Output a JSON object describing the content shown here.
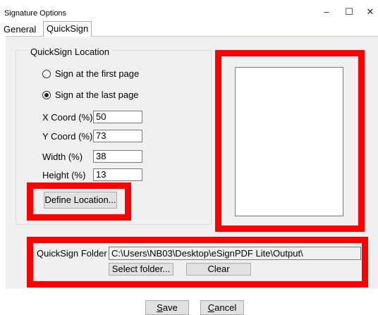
{
  "window": {
    "title": "Signature Options",
    "minimize_glyph": "–",
    "maximize_glyph": "☐",
    "close_glyph": "✕"
  },
  "tabs": [
    {
      "label": "General",
      "active": false
    },
    {
      "label": "QuickSign",
      "active": true
    }
  ],
  "location_group": {
    "title": "QuickSign Location",
    "radio_first": {
      "label": "Sign at the first page",
      "checked": false
    },
    "radio_last": {
      "label": "Sign at the last page",
      "checked": true
    },
    "fields": [
      {
        "label": "X Coord (%)",
        "value": "50"
      },
      {
        "label": "Y Coord (%)",
        "value": "73"
      },
      {
        "label": "Width (%)",
        "value": "38"
      },
      {
        "label": "Height (%)",
        "value": "13"
      }
    ],
    "define_button": "Define Location..."
  },
  "folder": {
    "label": "QuickSign Folder",
    "path": "C:\\Users\\NB03\\Desktop\\eSignPDF Lite\\Output\\",
    "select_button": "Select folder...",
    "clear_button": "Clear"
  },
  "footer": {
    "save_first": "S",
    "save_rest": "ave",
    "cancel_first": "C",
    "cancel_rest": "ancel"
  },
  "highlight_color": "#ff0000"
}
